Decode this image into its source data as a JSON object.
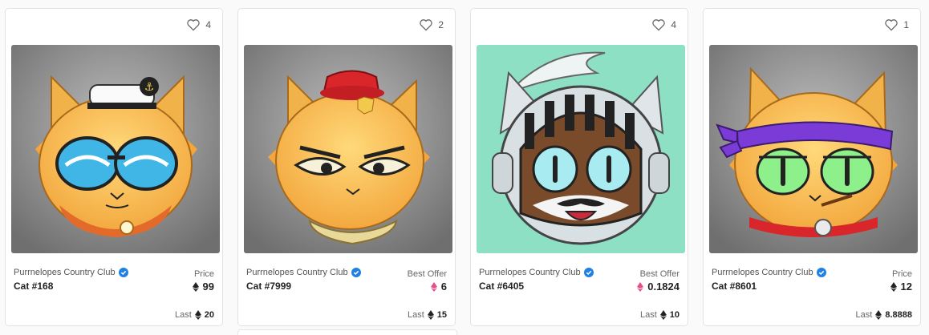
{
  "colors": {
    "eth_black": "#222222",
    "weth_pink": "#e84c86",
    "verified_blue": "#2081e2"
  },
  "cards": [
    {
      "likes": "4",
      "collection": "Purrnelopes Country Club",
      "name": "Cat #168",
      "price_label": "Price",
      "price": "99",
      "price_currency": "eth-icon",
      "last_label": "Last",
      "last": "20"
    },
    {
      "likes": "2",
      "collection": "Purrnelopes Country Club",
      "name": "Cat #7999",
      "price_label": "Best Offer",
      "price": "6",
      "price_currency": "weth-icon",
      "last_label": "Last",
      "last": "15"
    },
    {
      "likes": "4",
      "collection": "Purrnelopes Country Club",
      "name": "Cat #6405",
      "price_label": "Best Offer",
      "price": "0.1824",
      "price_currency": "weth-icon",
      "last_label": "Last",
      "last": "10"
    },
    {
      "likes": "1",
      "collection": "Purrnelopes Country Club",
      "name": "Cat #8601",
      "price_label": "Price",
      "price": "12",
      "price_currency": "eth-icon",
      "last_label": "Last",
      "last": "8.8888"
    }
  ]
}
